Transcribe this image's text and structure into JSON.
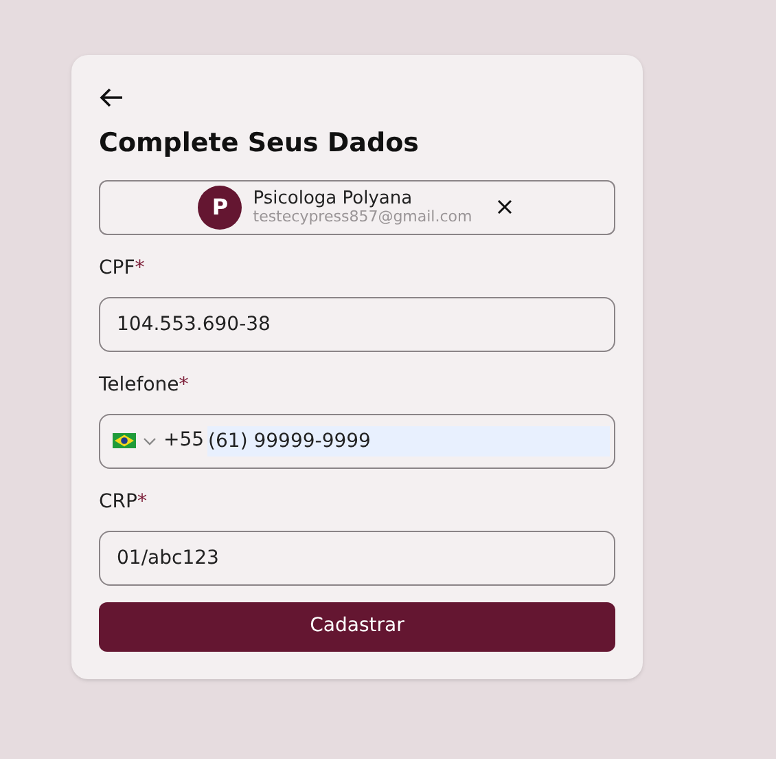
{
  "title": "Complete Seus Dados",
  "user": {
    "initial": "P",
    "name": "Psicologa Polyana",
    "email": "testecypress857@gmail.com"
  },
  "fields": [
    {
      "kind": "text",
      "label": "CPF",
      "required_mark": "*",
      "value": "104.553.690-38"
    },
    {
      "kind": "phone",
      "label": "Telefone",
      "required_mark": "*",
      "dial_code": "+55",
      "value": "(61) 99999-9999",
      "autofilled": true
    },
    {
      "kind": "text",
      "label": "CRP",
      "required_mark": "*",
      "value": "01/abc123"
    }
  ],
  "submit": "Cadastrar"
}
